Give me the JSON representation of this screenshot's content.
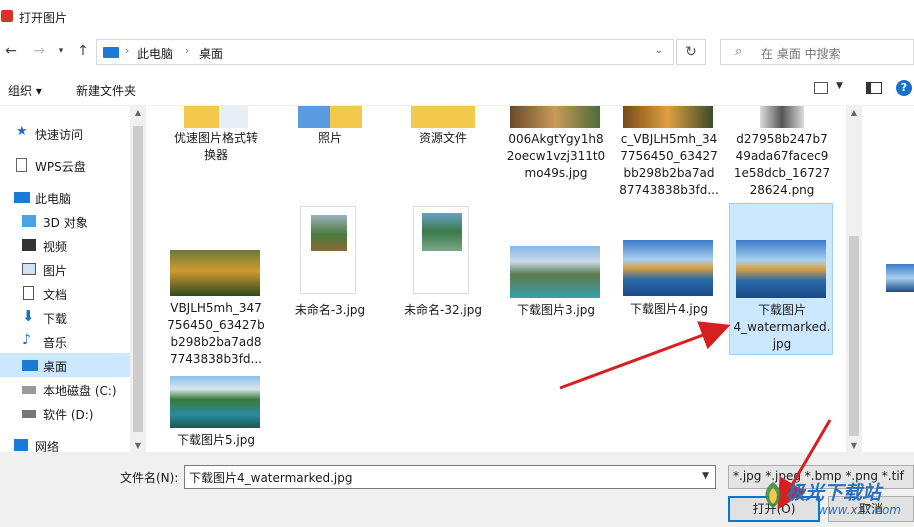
{
  "window": {
    "title": "打开图片"
  },
  "nav": {
    "path": [
      "此电脑",
      "桌面"
    ],
    "search_placeholder": "在 桌面 中搜索"
  },
  "toolbar": {
    "organize": "组织 ▾",
    "new_folder": "新建文件夹"
  },
  "sidebar": {
    "items": [
      {
        "label": "快速访问",
        "icon": "star-icon"
      },
      {
        "label": "WPS云盘",
        "icon": "cloud-doc-icon"
      },
      {
        "label": "此电脑",
        "icon": "computer-icon"
      },
      {
        "label": "3D 对象",
        "icon": "cube-icon"
      },
      {
        "label": "视频",
        "icon": "video-icon"
      },
      {
        "label": "图片",
        "icon": "picture-icon"
      },
      {
        "label": "文档",
        "icon": "document-icon"
      },
      {
        "label": "下载",
        "icon": "download-icon"
      },
      {
        "label": "音乐",
        "icon": "music-icon"
      },
      {
        "label": "桌面",
        "icon": "desktop-icon",
        "selected": true
      },
      {
        "label": "本地磁盘 (C:)",
        "icon": "drive-icon"
      },
      {
        "label": "软件 (D:)",
        "icon": "drive-icon"
      },
      {
        "label": "网络",
        "icon": "network-icon"
      }
    ]
  },
  "files": [
    {
      "name": "优速图片格式转换器",
      "lines": [
        "优速图片格式转",
        "换器"
      ],
      "kind": "folder"
    },
    {
      "name": "照片",
      "lines": [
        "照片"
      ],
      "kind": "folder"
    },
    {
      "name": "资源文件",
      "lines": [
        "资源文件"
      ],
      "kind": "folder"
    },
    {
      "name": "006AkgtYgy1h82oecw1vzj311t0mo49s.jpg",
      "lines": [
        "006AkgtYgy1h8",
        "2oecw1vzj311t0",
        "mo49s.jpg"
      ],
      "kind": "image"
    },
    {
      "name": "c_VBJLH5mh_347756450_63427bb298b2ba7ad87743838b3fd...",
      "lines": [
        "c_VBJLH5mh_34",
        "7756450_63427",
        "bb298b2ba7ad",
        "87743838b3fd..."
      ],
      "kind": "image"
    },
    {
      "name": "d27958b247b749ada67facec91e58dcb_1672728624.png",
      "lines": [
        "d27958b247b7",
        "49ada67facec9",
        "1e58dcb_16727",
        "28624.png"
      ],
      "kind": "image"
    },
    {
      "name": "VBJLH5mh_347756450_63427bb298b2ba7ad87743838b3fd...",
      "lines": [
        "VBJLH5mh_347",
        "756450_63427b",
        "b298b2ba7ad8",
        "7743838b3fd..."
      ],
      "kind": "image"
    },
    {
      "name": "未命名-3.jpg",
      "lines": [
        "未命名-3.jpg"
      ],
      "kind": "image"
    },
    {
      "name": "未命名-32.jpg",
      "lines": [
        "未命名-32.jpg"
      ],
      "kind": "image"
    },
    {
      "name": "下载图片3.jpg",
      "lines": [
        "下载图片3.jpg"
      ],
      "kind": "image"
    },
    {
      "name": "下载图片4.jpg",
      "lines": [
        "下载图片4.jpg"
      ],
      "kind": "image"
    },
    {
      "name": "下载图片4_watermarked.jpg",
      "lines": [
        "下载图片",
        "4_watermarked.",
        "jpg"
      ],
      "kind": "image",
      "selected": true
    },
    {
      "name": "下载图片5.jpg",
      "lines": [
        "下载图片5.jpg"
      ],
      "kind": "image"
    }
  ],
  "bottom": {
    "filename_label": "文件名(N):",
    "filename_value": "下载图片4_watermarked.jpg",
    "filter_value": "*.jpg *.jpeg *.bmp *.png *.tif",
    "open_label": "打开(O)",
    "cancel_label": "取消"
  },
  "watermark": {
    "text": "极光下载站",
    "url": "www.xz7.com"
  },
  "colors": {
    "accent": "#0078d7",
    "selection": "#cce8ff",
    "arrow": "#d62020"
  }
}
